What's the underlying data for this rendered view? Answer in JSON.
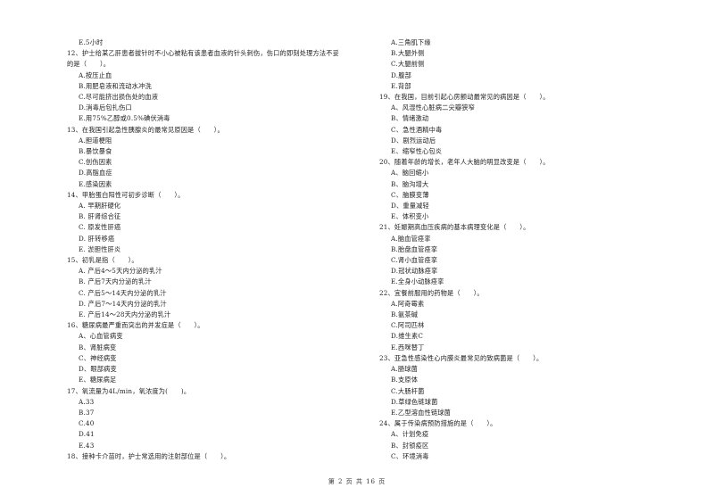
{
  "document": {
    "left_column": [
      {
        "type": "option",
        "text": "E.5小时"
      },
      {
        "type": "question",
        "text": "12、护士给某乙肝患者拔针时不小心被粘有该患者血液的针头刺伤，伤口的即刻处理方法不妥"
      },
      {
        "type": "question-cont",
        "text": "的是（　　）。"
      },
      {
        "type": "option",
        "text": "A.按压止血"
      },
      {
        "type": "option",
        "text": "B.用肥皂液和流动水冲洗"
      },
      {
        "type": "option",
        "text": "C.尽可能挤出损伤处的血液"
      },
      {
        "type": "option",
        "text": "D.消毒后包扎伤口"
      },
      {
        "type": "option",
        "text": "E.用75%乙醇或0.5%碘伏消毒"
      },
      {
        "type": "question",
        "text": "13、在我国引起急性胰腺炎的最常见原因是（　　）。"
      },
      {
        "type": "option",
        "text": "A.胆道梗阻"
      },
      {
        "type": "option",
        "text": "B.暴饮暴食"
      },
      {
        "type": "option",
        "text": "C.创伤因素"
      },
      {
        "type": "option",
        "text": "D.高脂血症"
      },
      {
        "type": "option",
        "text": "E.感染因素"
      },
      {
        "type": "question",
        "text": "14、甲胎蛋白阳性可初步诊断（　　）。"
      },
      {
        "type": "option",
        "text": "A. 早期肝硬化"
      },
      {
        "type": "option",
        "text": "B. 肝肾综合征"
      },
      {
        "type": "option",
        "text": "C. 原发性肝癌"
      },
      {
        "type": "option",
        "text": "D. 肝转移癌"
      },
      {
        "type": "option",
        "text": "E. 淤胆性肝炎"
      },
      {
        "type": "question",
        "text": "15、初乳是指（　　）。"
      },
      {
        "type": "option",
        "text": "A. 产后4～5天内分泌的乳汁"
      },
      {
        "type": "option",
        "text": "B. 产后7天内分泌的乳汁"
      },
      {
        "type": "option",
        "text": "C. 产后5～14天内分泌的乳汁"
      },
      {
        "type": "option",
        "text": "D. 产后7～14天内分泌的乳汁"
      },
      {
        "type": "option",
        "text": "E. 产后14～28天内分泌的乳汁"
      },
      {
        "type": "question",
        "text": "16、糖尿病最严重而突出的并发症是（　　）。"
      },
      {
        "type": "option",
        "text": "A、心血管病变"
      },
      {
        "type": "option",
        "text": "B、肾脏病变"
      },
      {
        "type": "option",
        "text": "C、神经病变"
      },
      {
        "type": "option",
        "text": "D、眼部病变"
      },
      {
        "type": "option",
        "text": "E、糖尿病足"
      },
      {
        "type": "question",
        "text": "17、氧流量为4L/min，氧浓度为(　　)。"
      },
      {
        "type": "option",
        "text": "A.33"
      },
      {
        "type": "option",
        "text": "B.37"
      },
      {
        "type": "option",
        "text": "C.40"
      },
      {
        "type": "option",
        "text": "D.41"
      },
      {
        "type": "option",
        "text": "E.43"
      },
      {
        "type": "question",
        "text": "18、接种卡介苗时，护士常选用的注射部位是（　　）。"
      }
    ],
    "right_column": [
      {
        "type": "option",
        "text": "A.三角肌下缘"
      },
      {
        "type": "option",
        "text": "B.大腿外侧"
      },
      {
        "type": "option",
        "text": "C.大腿前侧"
      },
      {
        "type": "option",
        "text": "D.腹部"
      },
      {
        "type": "option",
        "text": "E.背部"
      },
      {
        "type": "question",
        "text": "19、在我国，目前引起心房颤动最常见的病因是（　　）。"
      },
      {
        "type": "option",
        "text": "A、风湿性心脏病二尖瓣狭窄"
      },
      {
        "type": "option",
        "text": "B、情绪激动"
      },
      {
        "type": "option",
        "text": "C、急性酒精中毒"
      },
      {
        "type": "option",
        "text": "D、剧烈运动后"
      },
      {
        "type": "option",
        "text": "E、缩窄性心包炎"
      },
      {
        "type": "question",
        "text": "20、随着年龄的增长，老年人大脑的明显改变是（　　）。"
      },
      {
        "type": "option",
        "text": "A、脑回缩小"
      },
      {
        "type": "option",
        "text": "B、脑沟增大"
      },
      {
        "type": "option",
        "text": "C、脑膜变薄"
      },
      {
        "type": "option",
        "text": "D、重量减轻"
      },
      {
        "type": "option",
        "text": "E、体积变小"
      },
      {
        "type": "question",
        "text": "21、妊娠期高血压疾病的基本病理变化是（　　）。"
      },
      {
        "type": "option",
        "text": "A.脑血管痉挛"
      },
      {
        "type": "option",
        "text": "B.胎盘血管痉挛"
      },
      {
        "type": "option",
        "text": "C.肾小血管痉挛"
      },
      {
        "type": "option",
        "text": "D.冠状动脉痉挛"
      },
      {
        "type": "option",
        "text": "E.全身小动脉痉挛"
      },
      {
        "type": "question",
        "text": "22、宜餐前服用的药物是（　　）。"
      },
      {
        "type": "option",
        "text": "A.阿奇霉素"
      },
      {
        "type": "option",
        "text": "B.氨茶碱"
      },
      {
        "type": "option",
        "text": "C.阿司匹林"
      },
      {
        "type": "option",
        "text": "D.维生素C"
      },
      {
        "type": "option",
        "text": "E.西咪替丁"
      },
      {
        "type": "question",
        "text": "23、亚急性感染性心内膜炎最常见的致病菌是（　　）。"
      },
      {
        "type": "option",
        "text": "A.肠球菌"
      },
      {
        "type": "option",
        "text": "B.支原体"
      },
      {
        "type": "option",
        "text": "C.大肠杆菌"
      },
      {
        "type": "option",
        "text": "D.草绿色链球菌"
      },
      {
        "type": "option",
        "text": "E.乙型溶血性链球菌"
      },
      {
        "type": "question",
        "text": "24、属于传染病预防措施的是（　　）。"
      },
      {
        "type": "option",
        "text": "A、计划免疫"
      },
      {
        "type": "option",
        "text": "B、封锁疫区"
      },
      {
        "type": "option",
        "text": "C、环境消毒"
      }
    ],
    "footer": "第 2 页 共 16 页"
  }
}
